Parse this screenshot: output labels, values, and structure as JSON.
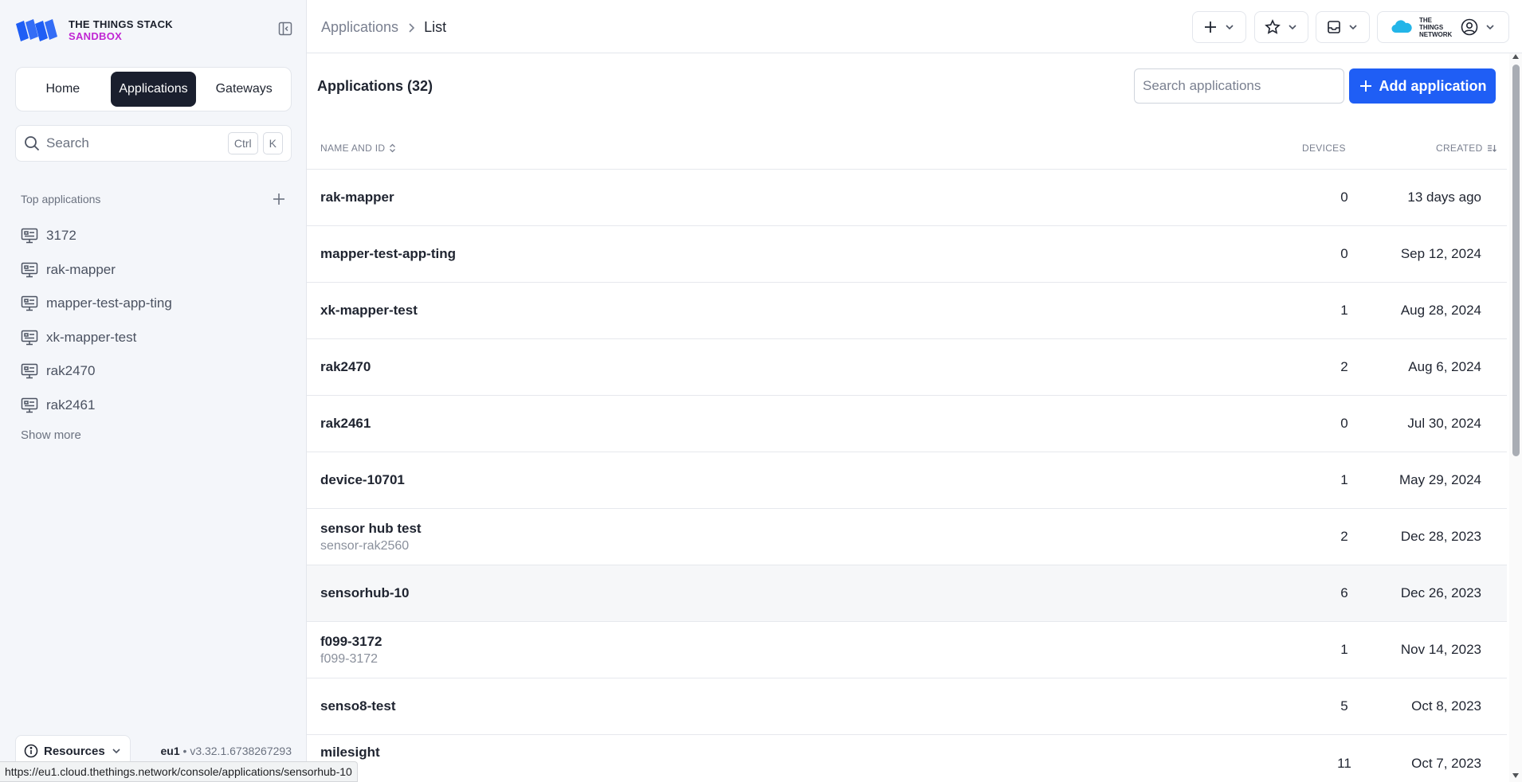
{
  "brand": {
    "line1": "THE THINGS STACK",
    "line2": "SANDBOX"
  },
  "switcher": {
    "tabs": [
      "Home",
      "Applications",
      "Gateways"
    ],
    "active": "Applications"
  },
  "sidebar_search": {
    "placeholder": "Search",
    "shortcut": [
      "Ctrl",
      "K"
    ]
  },
  "top_apps": {
    "label": "Top applications",
    "items": [
      "3172",
      "rak-mapper",
      "mapper-test-app-ting",
      "xk-mapper-test",
      "rak2470",
      "rak2461"
    ],
    "show_more": "Show more"
  },
  "footer": {
    "resources": "Resources",
    "cluster": "eu1",
    "separator": "•",
    "version": "v3.32.1.6738267293"
  },
  "breadcrumb": {
    "parent": "Applications",
    "current": "List"
  },
  "header": {
    "tti_logo": "THE THINGS NETWORK"
  },
  "page": {
    "title": "Applications (32)",
    "search_placeholder": "Search applications",
    "add_button": "Add application"
  },
  "table": {
    "headers": {
      "name": "NAME AND ID",
      "devices": "DEVICES",
      "created": "CREATED"
    },
    "rows": [
      {
        "name": "rak-mapper",
        "id": "",
        "devices": "0",
        "created": "13 days ago"
      },
      {
        "name": "mapper-test-app-ting",
        "id": "",
        "devices": "0",
        "created": "Sep 12, 2024"
      },
      {
        "name": "xk-mapper-test",
        "id": "",
        "devices": "1",
        "created": "Aug 28, 2024"
      },
      {
        "name": "rak2470",
        "id": "",
        "devices": "2",
        "created": "Aug 6, 2024"
      },
      {
        "name": "rak2461",
        "id": "",
        "devices": "0",
        "created": "Jul 30, 2024"
      },
      {
        "name": "device-10701",
        "id": "",
        "devices": "1",
        "created": "May 29, 2024"
      },
      {
        "name": "sensor hub test",
        "id": "sensor-rak2560",
        "devices": "2",
        "created": "Dec 28, 2023"
      },
      {
        "name": "sensorhub-10",
        "id": "",
        "devices": "6",
        "created": "Dec 26, 2023"
      },
      {
        "name": "f099-3172",
        "id": "f099-3172",
        "devices": "1",
        "created": "Nov 14, 2023"
      },
      {
        "name": "senso8-test",
        "id": "",
        "devices": "5",
        "created": "Oct 8, 2023"
      },
      {
        "name": "milesight",
        "id": "",
        "devices": "11",
        "created": "Oct 7, 2023"
      }
    ]
  },
  "status_url": "https://eu1.cloud.thethings.network/console/applications/sensorhub-10",
  "colors": {
    "primary": "#1f5ef5",
    "active_tab": "#1a1f2e",
    "sandbox": "#c026d3",
    "logo": "#1f5ef5"
  }
}
